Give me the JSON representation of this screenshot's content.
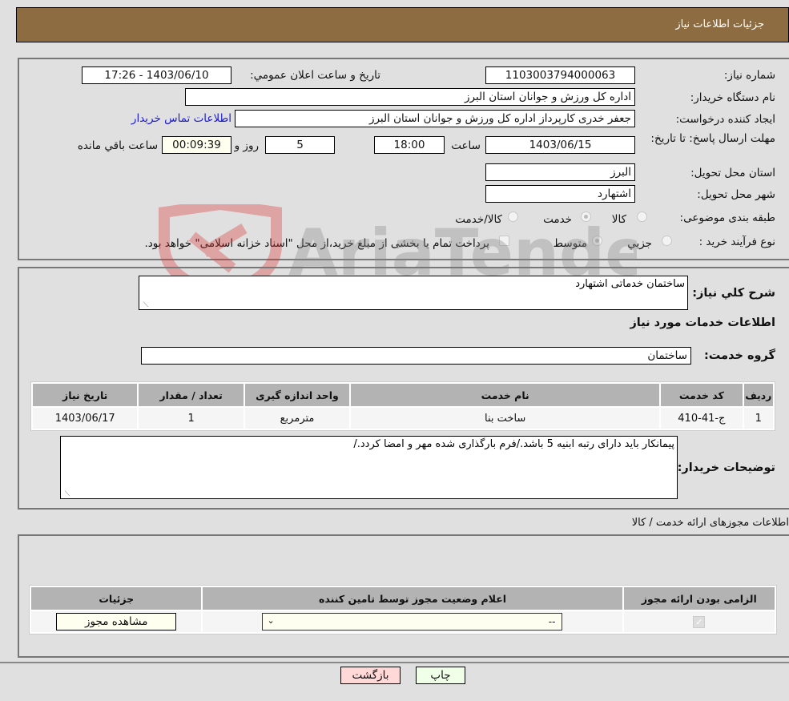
{
  "header": {
    "title": "جزئیات اطلاعات نیاز"
  },
  "details": {
    "need_number_label": "شماره نیاز:",
    "need_number": "1103003794000063",
    "announce_label": "تاریخ و ساعت اعلان عمومي:",
    "announce_value": "1403/06/10 - 17:26",
    "buyer_org_label": "نام دستگاه خریدار:",
    "buyer_org": "اداره کل ورزش و جوانان استان البرز",
    "creator_label": "ایجاد کننده درخواست:",
    "creator": "جعفر خدری کارپرداز اداره کل ورزش و جوانان استان البرز",
    "contact_link": "اطلاعات تماس خریدار",
    "deadline_label": "مهلت ارسال پاسخ: تا تاریخ:",
    "deadline_date": "1403/06/15",
    "time_label": "ساعت",
    "deadline_time": "18:00",
    "days": "5",
    "days_label": "روز و",
    "remaining": "00:09:39",
    "remaining_label": "ساعت باقي مانده",
    "province_label": "استان محل تحویل:",
    "province": "البرز",
    "city_label": "شهر محل تحویل:",
    "city": "اشتهارد",
    "category_label": "طبقه بندی موضوعی:",
    "category_options": [
      {
        "label": "کالا",
        "checked": false
      },
      {
        "label": "خدمت",
        "checked": true
      },
      {
        "label": "کالا/خدمت",
        "checked": false
      }
    ],
    "process_label": "نوع فرآیند خرید :",
    "process_options": [
      {
        "label": "جزيي",
        "checked": false
      },
      {
        "label": "متوسط",
        "checked": true
      }
    ],
    "treasury_note": "پرداخت تمام یا بخشی از مبلغ خرید،از محل \"اسناد خزانه اسلامی\" خواهد بود.",
    "treasury_checked": false
  },
  "description": {
    "label": "شرح كلي نیاز:",
    "value": "ساختمان خدماتی اشتهارد"
  },
  "services": {
    "section_title": "اطلاعات خدمات مورد نیاز",
    "group_label": "گروه خدمت:",
    "group_value": "ساختمان",
    "columns": [
      "ردیف",
      "کد خدمت",
      "نام خدمت",
      "واحد اندازه گیری",
      "تعداد / مقدار",
      "تاریخ نیاز"
    ],
    "rows": [
      {
        "index": "1",
        "code": "ج-41-410",
        "name": "ساخت بنا",
        "unit": "مترمربع",
        "qty": "1",
        "date": "1403/06/17"
      }
    ]
  },
  "buyer_notes": {
    "label": "توضیحات خریدار:",
    "value": "پیمانکار باید دارای رتبه ابنیه 5 باشد./فرم بارگذاری شده مهر و امضا کردد./"
  },
  "permits": {
    "section_title": "اطلاعات مجوزهای ارائه خدمت / کالا",
    "columns": [
      "الزامی بودن ارائه مجوز",
      "اعلام وضعیت مجوز توسط تامین کننده",
      "جزئیات"
    ],
    "rows": [
      {
        "required": true,
        "status": "--",
        "details_button": "مشاهده مجوز"
      }
    ]
  },
  "footer": {
    "print_label": "چاپ",
    "back_label": "بازگشت"
  },
  "watermark": {
    "text": "AriaTender.neT"
  }
}
